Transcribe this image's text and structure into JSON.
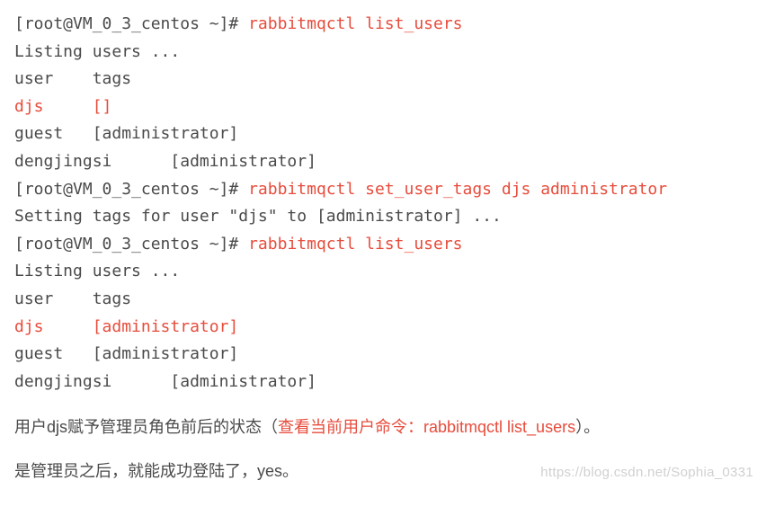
{
  "terminal": {
    "prompt": "[root@VM_0_3_centos ~]# ",
    "cmd_list_users": "rabbitmqctl list_users",
    "cmd_set_tags": "rabbitmqctl set_user_tags djs administrator",
    "listing_users": "Listing users ...",
    "header_user": "user",
    "header_tags": "tags",
    "first": {
      "djs_user": "djs",
      "djs_tags": "[]",
      "guest_line": "guest   [administrator]",
      "dengjingsi_line": "dengjingsi      [administrator]"
    },
    "setting_tags": "Setting tags for user \"djs\" to [administrator] ...",
    "second": {
      "djs_user": "djs",
      "djs_tags": "[administrator]",
      "guest_line": "guest   [administrator]",
      "dengjingsi_line": "dengjingsi      [administrator]"
    }
  },
  "prose": {
    "p1_before": "用户djs赋予管理员角色前后的状态（",
    "p1_red": "查看当前用户命令：rabbitmqctl list_users",
    "p1_after": "）。",
    "p2": "是管理员之后，就能成功登陆了，yes。"
  },
  "watermark": "https://blog.csdn.net/Sophia_0331"
}
